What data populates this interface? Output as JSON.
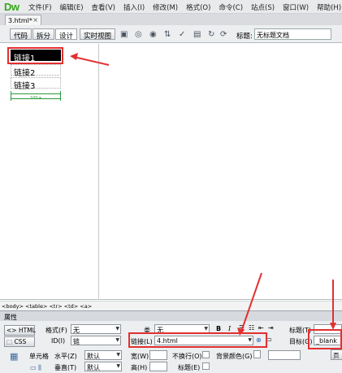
{
  "app": {
    "logo": "Dw",
    "menu": [
      "文件(F)",
      "编辑(E)",
      "查看(V)",
      "插入(I)",
      "修改(M)",
      "格式(O)",
      "命令(C)",
      "站点(S)",
      "窗口(W)",
      "帮助(H)"
    ],
    "document_tab": "3.html*",
    "tab_close": "×"
  },
  "toolbar": {
    "views": [
      "代码",
      "拆分",
      "设计",
      "实时视图"
    ],
    "active_view": "设计",
    "title_label": "标题:",
    "title_value": "无标题文档"
  },
  "design": {
    "cells": [
      "链接1",
      "链接2",
      "链接3"
    ],
    "width_label": "100 ▾"
  },
  "status": {
    "tag_selector": "<body> <table> <tr> <td> <a>"
  },
  "properties": {
    "panel_title": "属性",
    "html_tab": "HTML",
    "css_tab": "CSS",
    "format_label": "格式(F)",
    "format_value": "无",
    "class_label": "类",
    "class_value": "无",
    "bold": "B",
    "italic": "I",
    "id_label": "ID(I)",
    "id_value": "链",
    "link_label": "链接(L)",
    "link_value": "4.html",
    "heading_label": "标题(T)",
    "target_label": "目标(G)",
    "target_value": "_blank",
    "cell_label": "单元格",
    "horz_label": "水平(Z)",
    "horz_value": "默认",
    "vert_label": "垂直(T)",
    "vert_value": "默认",
    "width_label": "宽(W)",
    "height_label": "高(H)",
    "nowrap_label": "不换行(O)",
    "header_label": "标题(E)",
    "bg_label": "背景颜色(G)",
    "page_props": "页"
  },
  "colors": {
    "annotation": "#e23030",
    "logo": "#35a81b"
  }
}
